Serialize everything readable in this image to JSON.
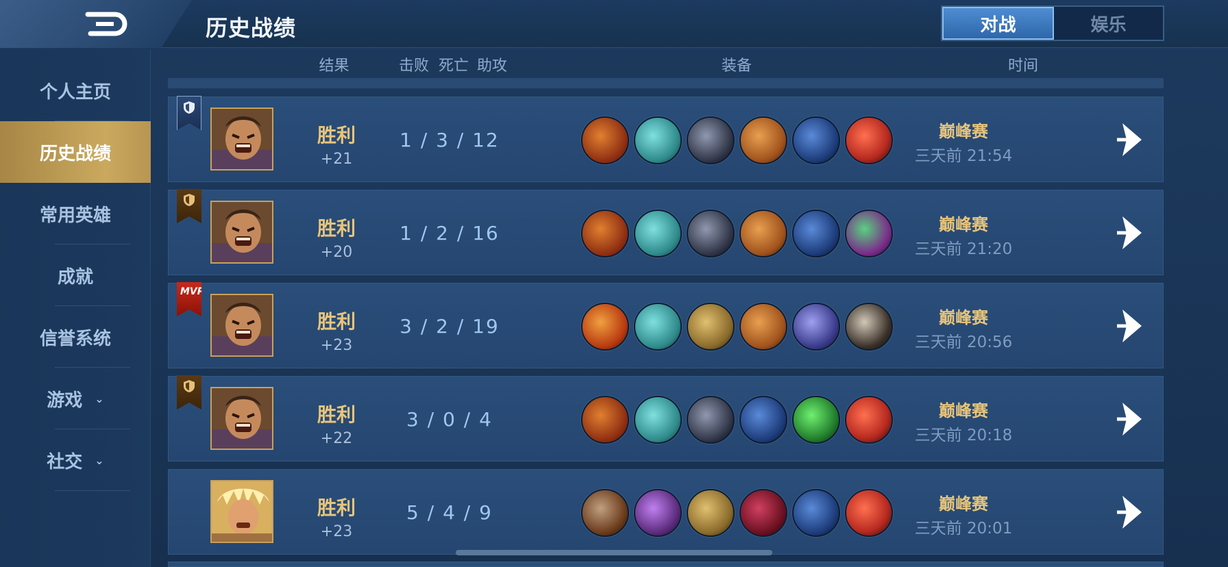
{
  "header": {
    "title": "历史战绩",
    "tabs": [
      {
        "label": "对战",
        "active": true
      },
      {
        "label": "娱乐",
        "active": false
      }
    ]
  },
  "sidebar": {
    "items": [
      {
        "label": "个人主页",
        "active": false
      },
      {
        "label": "历史战绩",
        "active": true
      },
      {
        "label": "常用英雄",
        "active": false
      },
      {
        "label": "成就",
        "active": false
      },
      {
        "label": "信誉系统",
        "active": false
      },
      {
        "label": "游戏",
        "active": false,
        "expandable": true
      },
      {
        "label": "社交",
        "active": false,
        "expandable": true
      }
    ]
  },
  "columns": {
    "result": "结果",
    "kills": "击败",
    "deaths": "死亡",
    "assists": "助攻",
    "equipment": "装备",
    "time": "时间"
  },
  "matches": [
    {
      "badge": "shield-blue",
      "hero": "hero-a",
      "result": "胜利",
      "points": "+21",
      "kda": "1 / 3 / 12",
      "items": [
        "#8a2a10",
        "#2f8a8a",
        "#2a2f40",
        "#a0521c",
        "#1d3c7a",
        "#b82a20"
      ],
      "mode": "巅峰赛",
      "time": "三天前 21:54"
    },
    {
      "badge": "shield-gold",
      "hero": "hero-a",
      "result": "胜利",
      "points": "+20",
      "kda": "1 / 2 / 16",
      "items": [
        "#8a2a10",
        "#2f8a8a",
        "#2a2f40",
        "#a0521c",
        "#1d3c7a",
        "#7a2a8a"
      ],
      "mode": "巅峰赛",
      "time": "三天前 21:20"
    },
    {
      "badge": "mvp",
      "mvp_label": "MVP",
      "hero": "hero-a",
      "result": "胜利",
      "points": "+23",
      "kda": "3 / 2 / 19",
      "items": [
        "#b83a10",
        "#2f8a8a",
        "#8a6a2a",
        "#a0521c",
        "#3a3a8a",
        "#3a3028"
      ],
      "mode": "巅峰赛",
      "time": "三天前 20:56"
    },
    {
      "badge": "shield-gold",
      "hero": "hero-a",
      "result": "胜利",
      "points": "+22",
      "kda": "3 / 0 / 4",
      "items": [
        "#8a2a10",
        "#2f8a8a",
        "#2a2f40",
        "#1d3c7a",
        "#1f7a2a",
        "#b82a20"
      ],
      "mode": "巅峰赛",
      "time": "三天前 20:18"
    },
    {
      "badge": "none",
      "hero": "hero-b",
      "result": "胜利",
      "points": "+23",
      "kda": "5 / 4 / 9",
      "items": [
        "#6a3a1a",
        "#5a2a7a",
        "#8a6a2a",
        "#6a1020",
        "#1d3c7a",
        "#b82a20"
      ],
      "mode": "巅峰赛",
      "time": "三天前 20:01"
    }
  ]
}
